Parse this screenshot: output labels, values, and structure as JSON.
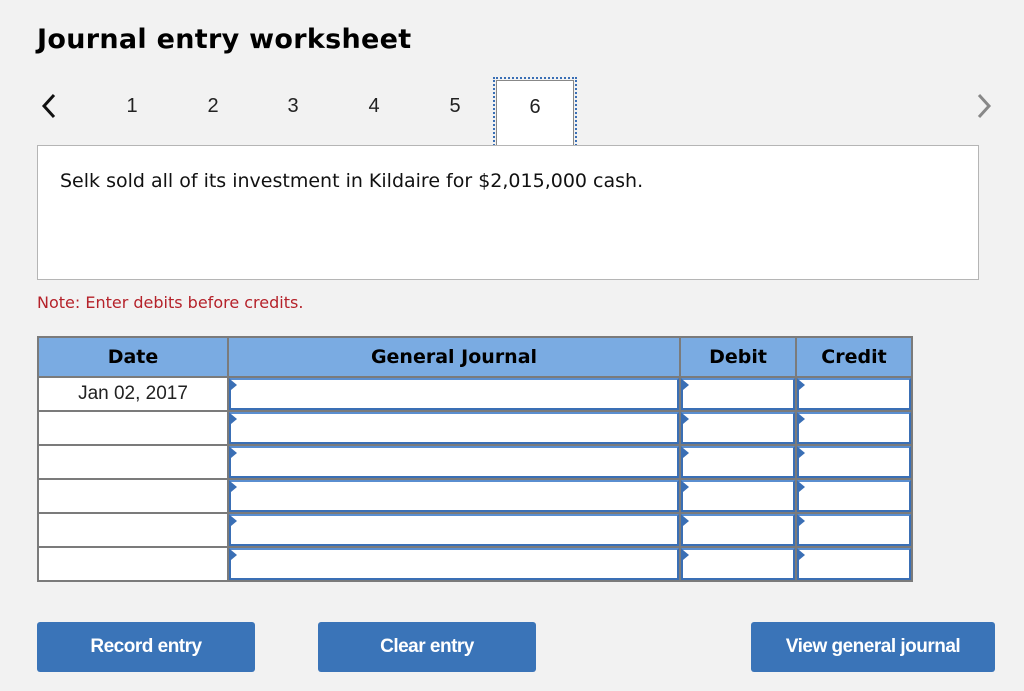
{
  "header": {
    "title": "Journal entry worksheet"
  },
  "pager": {
    "prev_icon": "chevron-left-icon",
    "next_icon": "chevron-right-icon",
    "pages": [
      "1",
      "2",
      "3",
      "4",
      "5",
      "6"
    ],
    "active_page": "6"
  },
  "prompt": {
    "text": "Selk sold all of its investment in Kildaire for $2,015,000 cash."
  },
  "note": {
    "text": "Note: Enter debits before credits."
  },
  "journal": {
    "columns": [
      "Date",
      "General Journal",
      "Debit",
      "Credit"
    ],
    "rows": [
      {
        "date": "Jan 02, 2017",
        "account": "",
        "debit": "",
        "credit": ""
      },
      {
        "date": "",
        "account": "",
        "debit": "",
        "credit": ""
      },
      {
        "date": "",
        "account": "",
        "debit": "",
        "credit": ""
      },
      {
        "date": "",
        "account": "",
        "debit": "",
        "credit": ""
      },
      {
        "date": "",
        "account": "",
        "debit": "",
        "credit": ""
      },
      {
        "date": "",
        "account": "",
        "debit": "",
        "credit": ""
      }
    ]
  },
  "buttons": {
    "record": "Record entry",
    "clear": "Clear entry",
    "view": "View general journal"
  },
  "colors": {
    "header_bg": "#7aabe2",
    "button_bg": "#3a74b8",
    "note_text": "#b5222a",
    "focus_outline": "#3a6fb5"
  }
}
